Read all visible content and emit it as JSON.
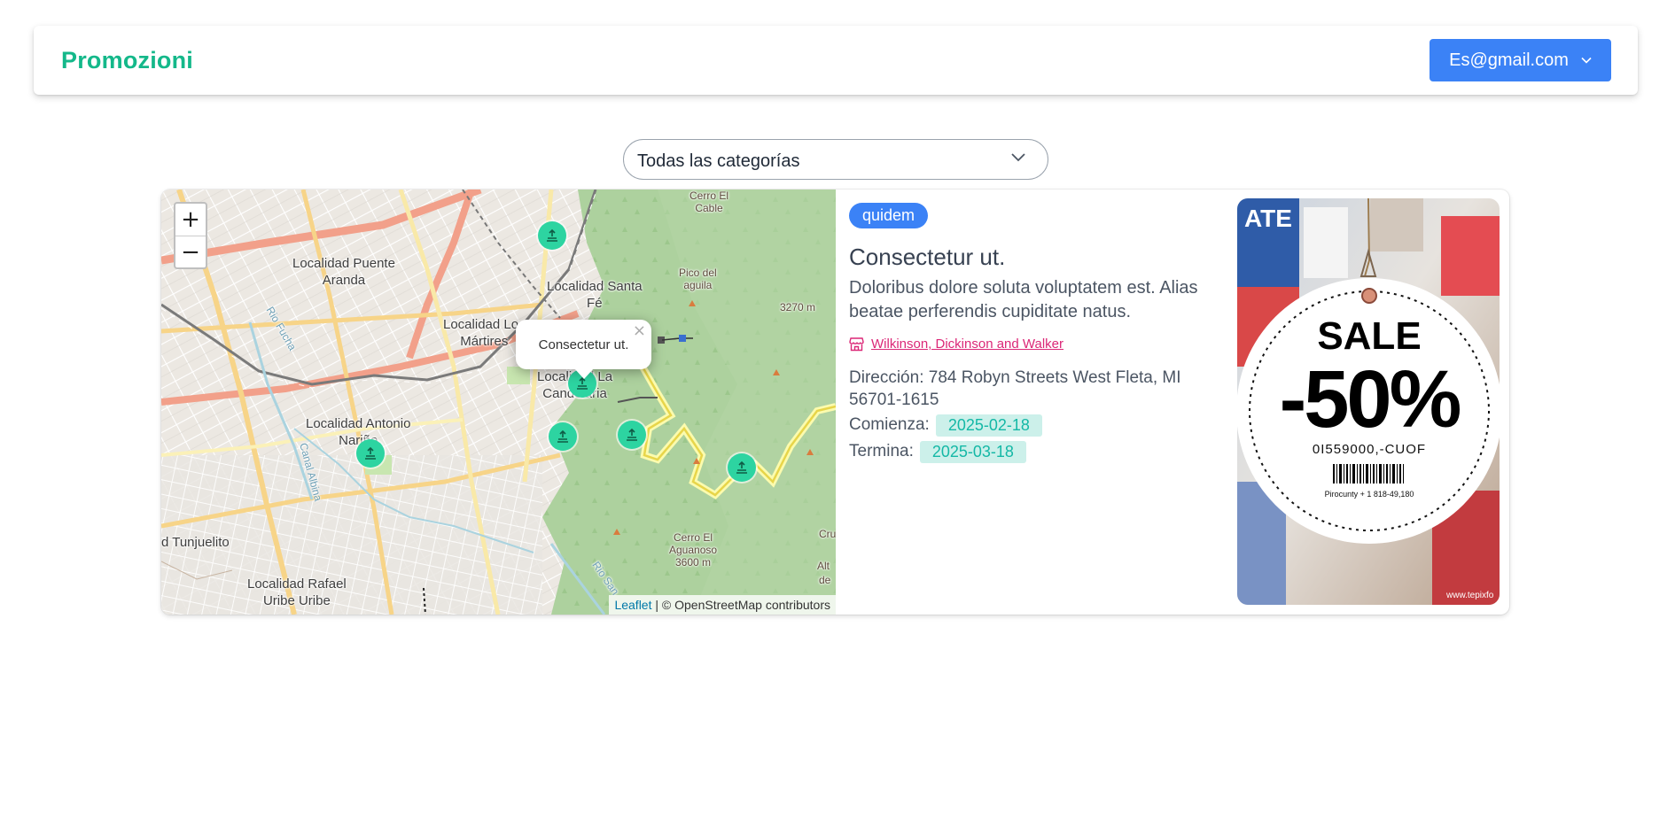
{
  "navbar": {
    "brand": "Promozioni",
    "user_email": "Es@gmail.com"
  },
  "filter": {
    "selected_category": "Todas las categorías"
  },
  "map": {
    "zoom_in": "+",
    "zoom_out": "−",
    "popup_text": "Consectetur ut.",
    "popup_close": "×",
    "attribution_link": "Leaflet",
    "attribution_text": " | © OpenStreetMap contributors",
    "labels": {
      "puente_aranda": "Localidad Puente\nAranda",
      "santa_fe": "Localidad Santa\nFé",
      "martires": "Localidad Los\nMártires",
      "candelaria": "Localidad La\nCandelaria",
      "antonio_narino": "Localidad Antonio\nNariño",
      "tunjuelito": "d Tunjuelito",
      "rafael_uribe": "Localidad Rafael\nUribe Uribe",
      "pico_aguila": "Pico del\naguila",
      "cerro_cable": "Cerro El\nCable",
      "cerro_aguanoso": "Cerro El\nAguanoso\n3600 m",
      "elev_3270": "3270 m",
      "rio_fucha": "Rio Fucha",
      "canal_albina": "Canal Albina",
      "rio_san": "Rio San",
      "cru": "Cru",
      "alt": "Alt",
      "de": "de"
    }
  },
  "promotion": {
    "category_badge": "quidem",
    "title": "Consectetur ut.",
    "description": "Doloribus dolore soluta voluptatem est. Alias beatae perferendis cupiditate natus.",
    "store_name": "Wilkinson, Dickinson and Walker",
    "address": "Dirección: 784 Robyn Streets West Fleta, MI 56701-1615",
    "start_label": "Comienza:",
    "start_date": "2025-02-18",
    "end_label": "Termina:",
    "end_date": "2025-03-18"
  },
  "promo_image": {
    "sale_text": "SALE",
    "discount_text": "-50%",
    "code_text": "0I559000,-CUOF",
    "small_text": "Pirocunty + 1 818-49,180",
    "watermark": "www.tepixfo",
    "brand_fragment": "ATE"
  },
  "colors": {
    "brand": "#14b88a",
    "primary": "#3b82f6",
    "marker": "#2dd4a1",
    "store_link": "#db2777",
    "date_chip_bg": "#ccf0ea",
    "date_chip_text": "#14b8a6"
  }
}
